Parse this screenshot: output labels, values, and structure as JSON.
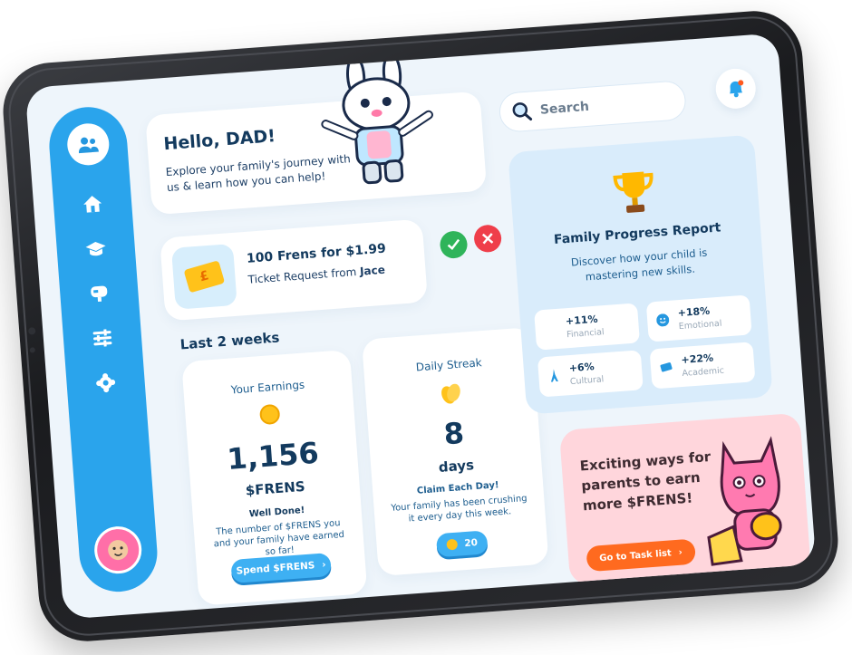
{
  "greeting": {
    "title": "Hello, DAD!",
    "subtitle": "Explore your family's journey with us & learn how you can help!"
  },
  "ticket_request": {
    "title": "100 Frens for $1.99",
    "label": "Ticket Request from",
    "requester": "Jace"
  },
  "section_title": "Last 2 weeks",
  "earnings": {
    "title": "Your Earnings",
    "amount": "1,156",
    "unit": "$FRENS",
    "headline": "Well Done!",
    "description": "The number of $FRENS you and your family have earned so far!",
    "button": "Spend $FRENS"
  },
  "streak": {
    "title": "Daily Streak",
    "count": "8",
    "unit": "days",
    "headline": "Claim Each Day!",
    "description": "Your family has been crushing it every day this week.",
    "reward": "20"
  },
  "search": {
    "placeholder": "Search"
  },
  "report": {
    "title": "Family Progress Report",
    "subtitle": "Discover how your child is mastering new skills.",
    "metrics": [
      {
        "value": "+11%",
        "label": "Financial",
        "icon": "none"
      },
      {
        "value": "+18%",
        "label": "Emotional",
        "icon": "smiley-icon"
      },
      {
        "value": "+6%",
        "label": "Cultural",
        "icon": "eiffel-tower-icon"
      },
      {
        "value": "+22%",
        "label": "Academic",
        "icon": "book-icon"
      }
    ]
  },
  "promo": {
    "text": "Exciting ways for parents to earn more $FRENS!",
    "button": "Go to Task list"
  },
  "colors": {
    "sidebar": "#2aa4ec",
    "accept": "#2fb45a",
    "reject": "#ef3e4a",
    "promo_bg": "#ffd6dc",
    "promo_button": "#ff6a1f"
  },
  "nav_icons": [
    "family-icon",
    "home-icon",
    "graduation-cap-icon",
    "mailbox-icon",
    "sliders-icon",
    "settings-icon"
  ]
}
